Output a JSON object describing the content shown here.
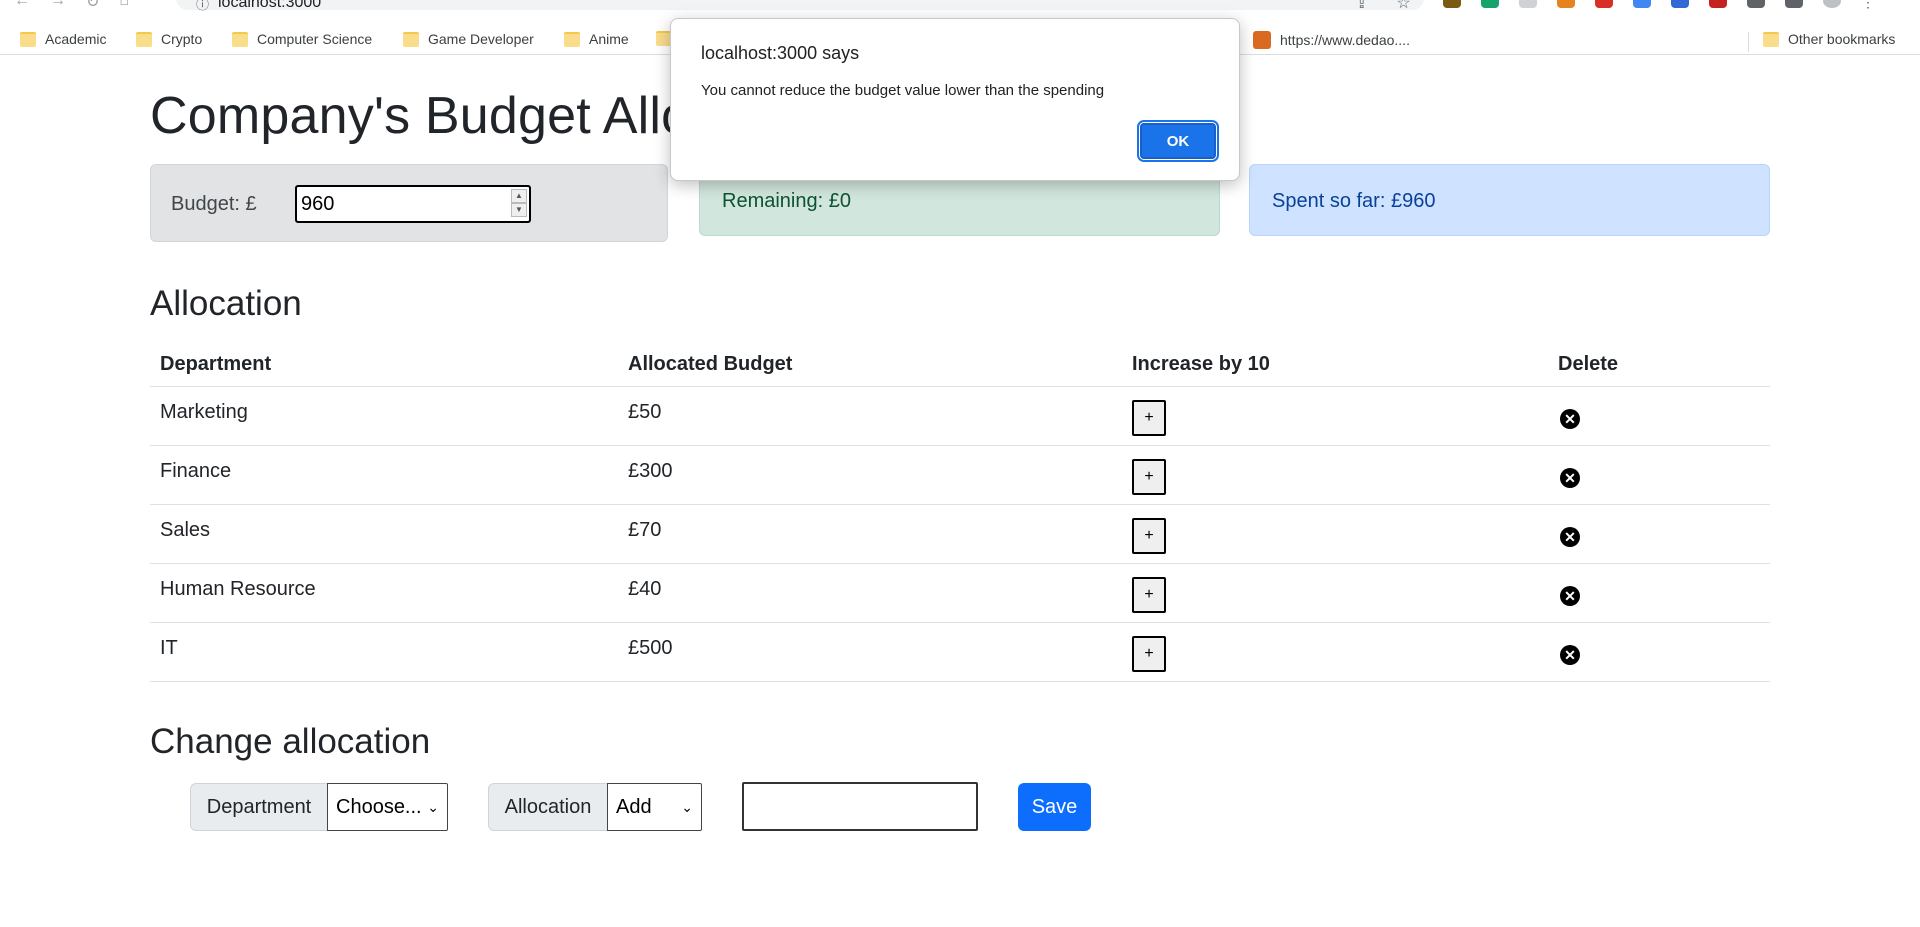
{
  "browser": {
    "url": "localhost:3000",
    "bookmarks": [
      "Academic",
      "Crypto",
      "Computer Science",
      "Game Developer",
      "Anime",
      "https://www.dedao....",
      "Other bookmarks"
    ]
  },
  "page": {
    "title": "Company's Budget Allo"
  },
  "budget": {
    "label": "Budget: £",
    "value": "960",
    "remaining": "Remaining: £0",
    "spent": "Spent so far: £960"
  },
  "allocation": {
    "title": "Allocation",
    "headers": [
      "Department",
      "Allocated Budget",
      "Increase by 10",
      "Delete"
    ],
    "rows": [
      {
        "department": "Marketing",
        "budget": "£50",
        "increase": "+",
        "delete": "✕"
      },
      {
        "department": "Finance",
        "budget": "£300",
        "increase": "+",
        "delete": "✕"
      },
      {
        "department": "Sales",
        "budget": "£70",
        "increase": "+",
        "delete": "✕"
      },
      {
        "department": "Human Resource",
        "budget": "£40",
        "increase": "+",
        "delete": "✕"
      },
      {
        "department": "IT",
        "budget": "£500",
        "increase": "+",
        "delete": "✕"
      }
    ]
  },
  "change": {
    "title": "Change allocation",
    "department_label": "Department",
    "department_value": "Choose...",
    "allocation_label": "Allocation",
    "allocation_value": "Add",
    "amount_value": "",
    "save_label": "Save"
  },
  "dialog": {
    "title": "localhost:3000 says",
    "message": "You cannot reduce the budget value lower than the spending",
    "ok_label": "OK"
  },
  "colors": {
    "remaining_bg": "#d1e7dd",
    "spent_bg": "#cfe2ff",
    "budget_bg": "#e2e3e5",
    "save_bg": "#0d6efd",
    "dialog_ok_bg": "#1a73e8"
  }
}
